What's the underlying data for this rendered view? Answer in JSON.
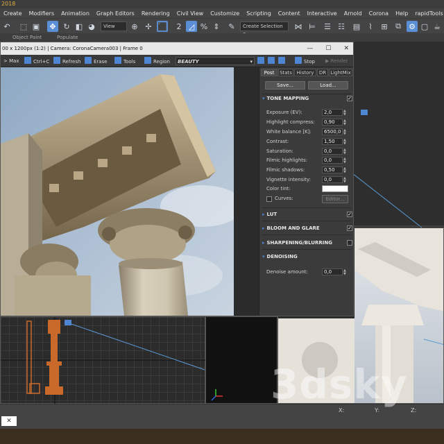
{
  "app": {
    "title": "2018"
  },
  "menu": [
    "Create",
    "Modifiers",
    "Animation",
    "Graph Editors",
    "Rendering",
    "Civil View",
    "Customize",
    "Scripting",
    "Content",
    "Interactive",
    "Arnold",
    "Corona",
    "Help",
    "rapidTools"
  ],
  "toolbar": {
    "view_dropdown": "View",
    "selection_set": "Create Selection Se"
  },
  "ribbon": {
    "object_paint": "Object Paint",
    "populate": "Populate"
  },
  "vfb": {
    "title": "00 x 1200px (1:2) | Camera: CoronaCamera003 | Frame 0",
    "buttons": {
      "max": "> Max",
      "ctrlc": "Ctrl+C",
      "refresh": "Refresh",
      "erase": "Erase",
      "tools": "Tools",
      "region": "Region",
      "stop": "Stop",
      "render": "Render"
    },
    "channel": "BEAUTY"
  },
  "panel": {
    "tabs": [
      "Post",
      "Stats",
      "History",
      "DR",
      "LightMix"
    ],
    "save": "Save...",
    "load": "Load...",
    "sections": {
      "tone_mapping": "TONE MAPPING",
      "lut": "LUT",
      "bloom": "BLOOM AND GLARE",
      "sharpen": "SHARPENING/BLURRING",
      "denoise": "DENOISING"
    },
    "params": [
      {
        "label": "Exposure (EV):",
        "value": "2,0"
      },
      {
        "label": "Highlight compress:",
        "value": "0,90"
      },
      {
        "label": "White balance [K]:",
        "value": "6500,0"
      },
      {
        "label": "Contrast:",
        "value": "1,50"
      },
      {
        "label": "Saturation:",
        "value": "0,0"
      },
      {
        "label": "Filmic highlights:",
        "value": "0,0"
      },
      {
        "label": "Filmic shadows:",
        "value": "0,50"
      },
      {
        "label": "Vignette intensity:",
        "value": "0,0"
      }
    ],
    "color_tint": "Color tint:",
    "curves": "Curves:",
    "editor": "Editor...",
    "denoise_label": "Denoise amount:",
    "denoise_value": "0,0"
  },
  "status": {
    "x_label": "X:",
    "y_label": "Y:",
    "z_label": "Z:"
  },
  "watermark": "3dsky"
}
